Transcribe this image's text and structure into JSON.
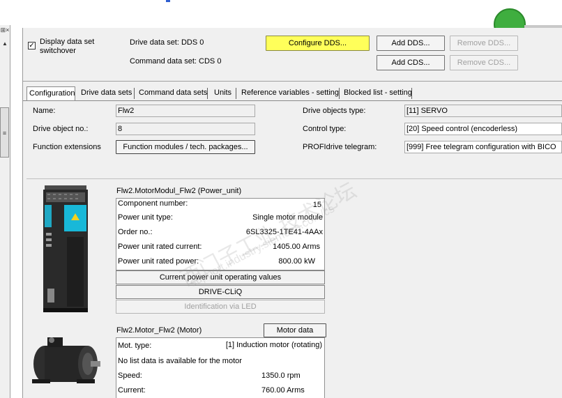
{
  "display_switchover": {
    "label": "Display data set switchover",
    "checked": true
  },
  "data_sets": {
    "drive_label": "Drive data set: DDS 0",
    "command_label": "Command data set: CDS 0",
    "configure_dds": "Configure DDS...",
    "add_dds": "Add DDS...",
    "remove_dds": "Remove DDS...",
    "add_cds": "Add CDS...",
    "remove_cds": "Remove CDS..."
  },
  "tabs": [
    {
      "label": "Configuration"
    },
    {
      "label": "Drive data sets"
    },
    {
      "label": "Command data sets"
    },
    {
      "label": "Units"
    },
    {
      "label": "Reference variables - setting"
    },
    {
      "label": "Blocked list - setting"
    }
  ],
  "config": {
    "name_label": "Name:",
    "name_value": "Flw2",
    "drive_object_no_label": "Drive object no.:",
    "drive_object_no_value": "8",
    "function_ext_label": "Function extensions",
    "function_ext_button": "Function modules / tech. packages...",
    "drive_objects_type_label": "Drive objects type:",
    "drive_objects_type_value": "[11] SERVO",
    "control_type_label": "Control type:",
    "control_type_value": "[20] Speed control (encoderless)",
    "telegram_label": "PROFIdrive telegram:",
    "telegram_value": "[999] Free telegram configuration with BICO"
  },
  "power_unit": {
    "title": "Flw2.MotorModul_Flw2 (Power_unit)",
    "rows": [
      {
        "label": "Component number:",
        "value": "15"
      },
      {
        "label": "Power unit type:",
        "value": "Single motor module"
      },
      {
        "label": "Order no.:",
        "value": "6SL3325-1TE41-4AAx"
      },
      {
        "label": "Power unit rated current:",
        "value": "1405.00 Arms"
      },
      {
        "label": "Power unit rated power:",
        "value": "800.00 kW"
      }
    ],
    "operating_values_button": "Current power unit operating values",
    "drive_cliq_button": "DRIVE-CLiQ",
    "identification_button": "Identification via LED"
  },
  "motor": {
    "title": "Flw2.Motor_Flw2 (Motor)",
    "motor_data_button": "Motor data",
    "type_label": "Mot. type:",
    "type_value": "[1] Induction motor (rotating)",
    "no_list_text": "No list data is available for the motor",
    "speed_label": "Speed:",
    "speed_value": "1350.0 rpm",
    "current_label": "Current:",
    "current_value": "760.00 Arms"
  },
  "watermark": {
    "line1": "西门子工业  技术论坛",
    "line2": "support.industry.siemens.com/cs"
  },
  "colors": {
    "panel_bg": "#f0f0f0",
    "configure_button": "#ffff5a",
    "green_indicator": "#3fae3f"
  }
}
